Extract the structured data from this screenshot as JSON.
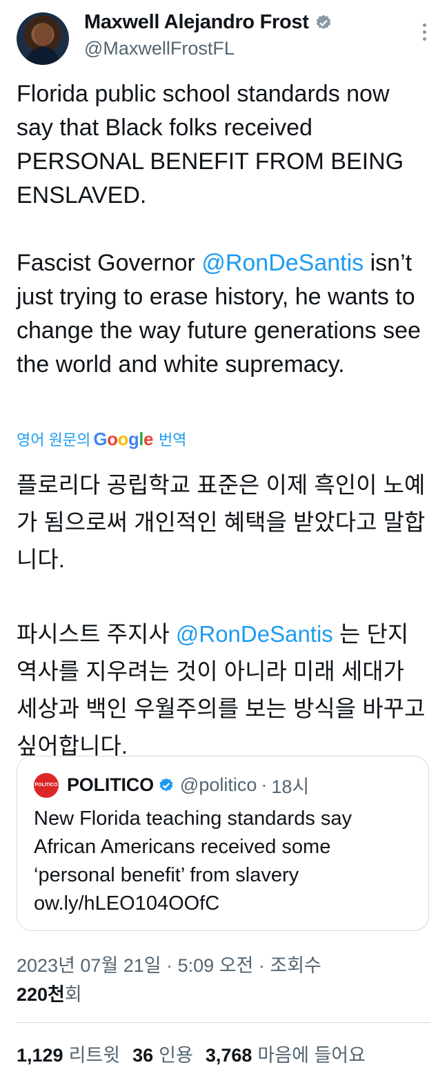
{
  "author": {
    "display_name": "Maxwell Alejandro Frost",
    "handle": "@MaxwellFrostFL"
  },
  "tweet": {
    "paragraphs": [
      {
        "text": "Florida public school standards now say that Black folks received PERSONAL BENEFIT FROM BEING ENSLAVED."
      },
      {
        "before": "Fascist Governor ",
        "mention": "@RonDeSantis",
        "after": " isn’t just trying to erase history, he wants to change the way future generations see the world and white supremacy."
      }
    ]
  },
  "translation": {
    "prefix": "영어 원문의",
    "google_letters": [
      "G",
      "o",
      "o",
      "g",
      "l",
      "e"
    ],
    "suffix": "번역",
    "paragraphs": [
      {
        "text": "플로리다 공립학교 표준은 이제 흑인이 노예가 됨으로써 개인적인 혜택을 받았다고 말합니다."
      },
      {
        "before": "파시스트 주지사 ",
        "mention": "@RonDeSantis",
        "after": " 는 단지 역사를 지우려는 것이 아니라 미래 세대가 세상과 백인 우월주의를 보는 방식을 바꾸고 싶어합니다."
      }
    ]
  },
  "quote": {
    "logo_text": "POLITICO",
    "name": "POLITICO",
    "handle": "@politico",
    "separator": "·",
    "time": "18시",
    "text": "New Florida teaching standards say African Americans received some ‘personal benefit’ from slavery ow.ly/hLEO104OOfC"
  },
  "meta": {
    "timestamp": "2023년 07월 21일 · 5:09 오전 · 조회수",
    "views_count": "220천",
    "views_unit": "회"
  },
  "stats": [
    {
      "count": "1,129",
      "label": "리트윗"
    },
    {
      "count": "36",
      "label": "인용"
    },
    {
      "count": "3,768",
      "label": "마음에 들어요"
    }
  ],
  "colors": {
    "accent": "#1d9bf0",
    "text": "#0f1419",
    "secondary": "#536471",
    "border": "#cfd9de",
    "politico_red": "#dc2626"
  }
}
